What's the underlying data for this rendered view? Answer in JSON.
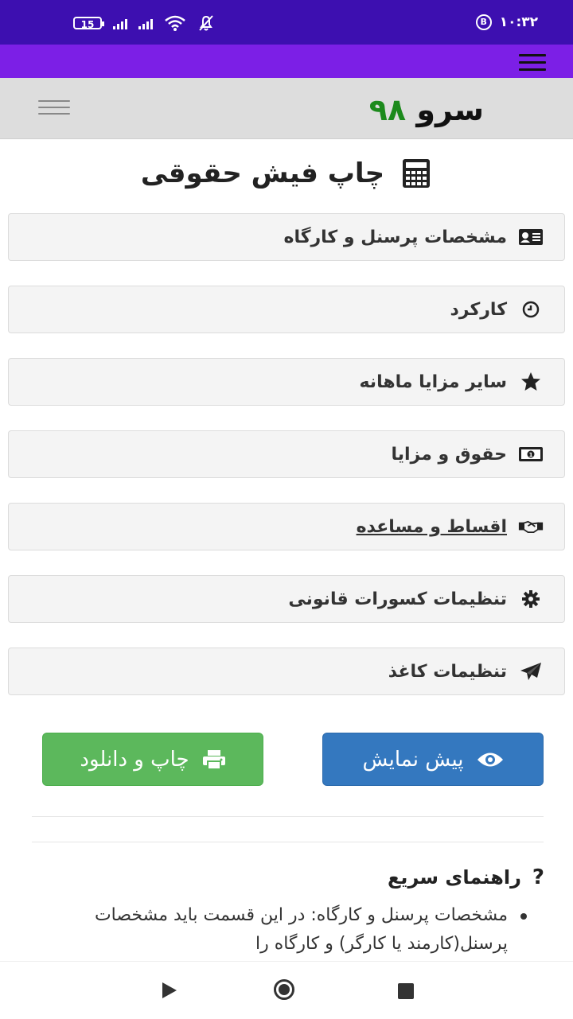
{
  "status_bar": {
    "battery": "15",
    "time": "۱۰:۳۲",
    "badge": "B"
  },
  "header": {
    "logo_word": "سرو",
    "logo_number": "۹۸"
  },
  "page": {
    "title": "چاپ فیش حقوقی"
  },
  "sections": [
    {
      "label": "مشخصات پرسنل و کارگاه",
      "icon": "id-card-icon"
    },
    {
      "label": "کارکرد",
      "icon": "clock-icon"
    },
    {
      "label": "سایر مزایا ماهانه",
      "icon": "star-icon"
    },
    {
      "label": "حقوق و مزایا",
      "icon": "money-icon"
    },
    {
      "label": "اقساط و مساعده",
      "icon": "handshake-icon"
    },
    {
      "label": "تنظیمات کسورات قانونی",
      "icon": "gear-icon"
    },
    {
      "label": "تنظیمات کاغذ",
      "icon": "paper-plane-icon"
    }
  ],
  "actions": {
    "preview_label": "پیش نمایش",
    "print_label": "چاپ و دانلود"
  },
  "help": {
    "title": "راهنمای سریع",
    "text": "مشخصات پرسنل و کارگاه: در این قسمت باید مشخصات پرسنل(کارمند یا کارگر) و کارگاه را"
  },
  "colors": {
    "status_bar": "#3d0fb0",
    "app_bar": "#7c1fe6",
    "header": "#dddddd",
    "logo_number": "#1c8a1c",
    "preview_button": "#3478bf",
    "print_button": "#5cb85c"
  }
}
